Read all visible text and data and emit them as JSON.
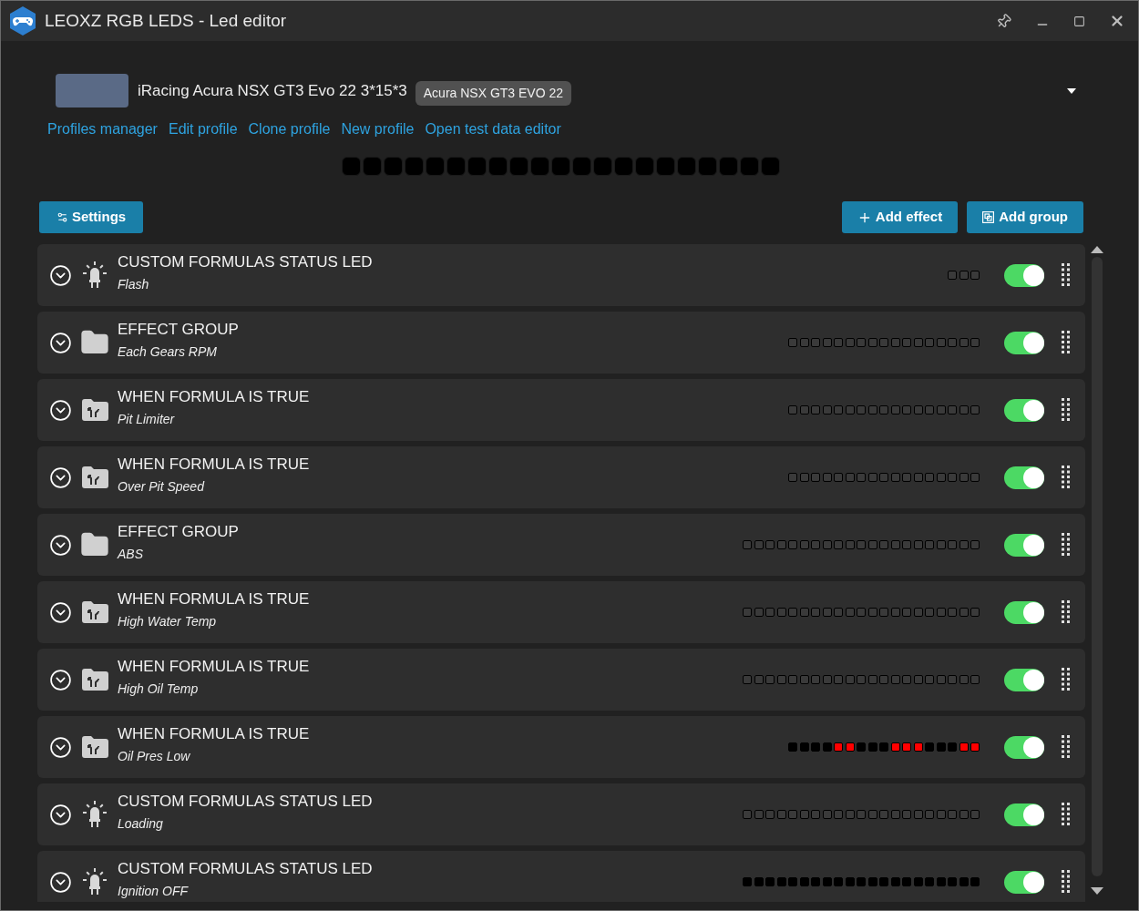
{
  "window": {
    "title": "LEOXZ RGB LEDS - Led editor"
  },
  "profile": {
    "name": "iRacing Acura NSX GT3 Evo 22 3*15*3",
    "badge": "Acura NSX GT3 EVO 22"
  },
  "links": [
    "Profiles manager",
    "Edit profile",
    "Clone profile",
    "New profile",
    "Open test data editor"
  ],
  "preview_leds": [
    {
      "color": "#000000"
    },
    {
      "color": "#000000"
    },
    {
      "color": "#000000"
    },
    {
      "color": "#000000"
    },
    {
      "color": "#000000"
    },
    {
      "color": "#000000"
    },
    {
      "color": "#000000"
    },
    {
      "color": "#000000"
    },
    {
      "color": "#000000"
    },
    {
      "color": "#000000"
    },
    {
      "color": "#000000"
    },
    {
      "color": "#000000"
    },
    {
      "color": "#000000"
    },
    {
      "color": "#000000"
    },
    {
      "color": "#000000"
    },
    {
      "color": "#000000"
    },
    {
      "color": "#000000"
    },
    {
      "color": "#000000"
    },
    {
      "color": "#000000"
    },
    {
      "color": "#000000"
    },
    {
      "color": "#000000"
    }
  ],
  "toolbar": {
    "settings": "Settings",
    "add_effect": "Add effect",
    "add_group": "Add group"
  },
  "effects": [
    {
      "kind": "status_led",
      "title": "CUSTOM FORMULAS STATUS LED",
      "subtitle": "Flash",
      "on": true,
      "leds": [
        {
          "kind": "outline"
        },
        {
          "kind": "outline"
        },
        {
          "kind": "outline"
        }
      ]
    },
    {
      "kind": "group",
      "title": "EFFECT GROUP",
      "subtitle": "Each Gears RPM",
      "on": true,
      "leds": [
        {
          "kind": "outline"
        },
        {
          "kind": "outline"
        },
        {
          "kind": "outline"
        },
        {
          "kind": "outline"
        },
        {
          "kind": "outline"
        },
        {
          "kind": "outline"
        },
        {
          "kind": "outline"
        },
        {
          "kind": "outline"
        },
        {
          "kind": "outline"
        },
        {
          "kind": "outline"
        },
        {
          "kind": "outline"
        },
        {
          "kind": "outline"
        },
        {
          "kind": "outline"
        },
        {
          "kind": "outline"
        },
        {
          "kind": "outline"
        },
        {
          "kind": "outline"
        },
        {
          "kind": "outline"
        }
      ]
    },
    {
      "kind": "formula",
      "title": "WHEN FORMULA IS TRUE",
      "subtitle": "Pit Limiter",
      "on": true,
      "leds": [
        {
          "kind": "outline"
        },
        {
          "kind": "outline"
        },
        {
          "kind": "outline"
        },
        {
          "kind": "outline"
        },
        {
          "kind": "outline"
        },
        {
          "kind": "outline"
        },
        {
          "kind": "outline"
        },
        {
          "kind": "outline"
        },
        {
          "kind": "outline"
        },
        {
          "kind": "outline"
        },
        {
          "kind": "outline"
        },
        {
          "kind": "outline"
        },
        {
          "kind": "outline"
        },
        {
          "kind": "outline"
        },
        {
          "kind": "outline"
        },
        {
          "kind": "outline"
        },
        {
          "kind": "outline"
        }
      ]
    },
    {
      "kind": "formula",
      "title": "WHEN FORMULA IS TRUE",
      "subtitle": "Over Pit Speed",
      "on": true,
      "leds": [
        {
          "kind": "outline"
        },
        {
          "kind": "outline"
        },
        {
          "kind": "outline"
        },
        {
          "kind": "outline"
        },
        {
          "kind": "outline"
        },
        {
          "kind": "outline"
        },
        {
          "kind": "outline"
        },
        {
          "kind": "outline"
        },
        {
          "kind": "outline"
        },
        {
          "kind": "outline"
        },
        {
          "kind": "outline"
        },
        {
          "kind": "outline"
        },
        {
          "kind": "outline"
        },
        {
          "kind": "outline"
        },
        {
          "kind": "outline"
        },
        {
          "kind": "outline"
        },
        {
          "kind": "outline"
        }
      ]
    },
    {
      "kind": "group",
      "title": "EFFECT GROUP",
      "subtitle": "ABS",
      "on": true,
      "leds": [
        {
          "kind": "outline"
        },
        {
          "kind": "outline"
        },
        {
          "kind": "outline"
        },
        {
          "kind": "outline"
        },
        {
          "kind": "outline"
        },
        {
          "kind": "outline"
        },
        {
          "kind": "outline"
        },
        {
          "kind": "outline"
        },
        {
          "kind": "outline"
        },
        {
          "kind": "outline"
        },
        {
          "kind": "outline"
        },
        {
          "kind": "outline"
        },
        {
          "kind": "outline"
        },
        {
          "kind": "outline"
        },
        {
          "kind": "outline"
        },
        {
          "kind": "outline"
        },
        {
          "kind": "outline"
        },
        {
          "kind": "outline"
        },
        {
          "kind": "outline"
        },
        {
          "kind": "outline"
        },
        {
          "kind": "outline"
        }
      ]
    },
    {
      "kind": "formula",
      "title": "WHEN FORMULA IS TRUE",
      "subtitle": "High Water Temp",
      "on": true,
      "leds": [
        {
          "kind": "outline"
        },
        {
          "kind": "outline"
        },
        {
          "kind": "outline"
        },
        {
          "kind": "outline"
        },
        {
          "kind": "outline"
        },
        {
          "kind": "outline"
        },
        {
          "kind": "outline"
        },
        {
          "kind": "outline"
        },
        {
          "kind": "outline"
        },
        {
          "kind": "outline"
        },
        {
          "kind": "outline"
        },
        {
          "kind": "outline"
        },
        {
          "kind": "outline"
        },
        {
          "kind": "outline"
        },
        {
          "kind": "outline"
        },
        {
          "kind": "outline"
        },
        {
          "kind": "outline"
        },
        {
          "kind": "outline"
        },
        {
          "kind": "outline"
        },
        {
          "kind": "outline"
        },
        {
          "kind": "outline"
        }
      ]
    },
    {
      "kind": "formula",
      "title": "WHEN FORMULA IS TRUE",
      "subtitle": "High Oil Temp",
      "on": true,
      "leds": [
        {
          "kind": "outline"
        },
        {
          "kind": "outline"
        },
        {
          "kind": "outline"
        },
        {
          "kind": "outline"
        },
        {
          "kind": "outline"
        },
        {
          "kind": "outline"
        },
        {
          "kind": "outline"
        },
        {
          "kind": "outline"
        },
        {
          "kind": "outline"
        },
        {
          "kind": "outline"
        },
        {
          "kind": "outline"
        },
        {
          "kind": "outline"
        },
        {
          "kind": "outline"
        },
        {
          "kind": "outline"
        },
        {
          "kind": "outline"
        },
        {
          "kind": "outline"
        },
        {
          "kind": "outline"
        },
        {
          "kind": "outline"
        },
        {
          "kind": "outline"
        },
        {
          "kind": "outline"
        },
        {
          "kind": "outline"
        }
      ]
    },
    {
      "kind": "formula",
      "title": "WHEN FORMULA IS TRUE",
      "subtitle": "Oil Pres Low",
      "on": true,
      "leds": [
        {
          "kind": "lit",
          "color": "#000000"
        },
        {
          "kind": "lit",
          "color": "#000000"
        },
        {
          "kind": "lit",
          "color": "#000000"
        },
        {
          "kind": "lit",
          "color": "#000000"
        },
        {
          "kind": "lit",
          "color": "#ff0000"
        },
        {
          "kind": "lit",
          "color": "#ff0000"
        },
        {
          "kind": "lit",
          "color": "#000000"
        },
        {
          "kind": "lit",
          "color": "#000000"
        },
        {
          "kind": "lit",
          "color": "#000000"
        },
        {
          "kind": "lit",
          "color": "#ff0000"
        },
        {
          "kind": "lit",
          "color": "#ff0000"
        },
        {
          "kind": "lit",
          "color": "#ff0000"
        },
        {
          "kind": "lit",
          "color": "#000000"
        },
        {
          "kind": "lit",
          "color": "#000000"
        },
        {
          "kind": "lit",
          "color": "#000000"
        },
        {
          "kind": "lit",
          "color": "#ff0000"
        },
        {
          "kind": "lit",
          "color": "#ff0000"
        }
      ]
    },
    {
      "kind": "status_led",
      "title": "CUSTOM FORMULAS STATUS LED",
      "subtitle": "Loading",
      "on": true,
      "leds": [
        {
          "kind": "outline"
        },
        {
          "kind": "outline"
        },
        {
          "kind": "outline"
        },
        {
          "kind": "outline"
        },
        {
          "kind": "outline"
        },
        {
          "kind": "outline"
        },
        {
          "kind": "outline"
        },
        {
          "kind": "outline"
        },
        {
          "kind": "outline"
        },
        {
          "kind": "outline"
        },
        {
          "kind": "outline"
        },
        {
          "kind": "outline"
        },
        {
          "kind": "outline"
        },
        {
          "kind": "outline"
        },
        {
          "kind": "outline"
        },
        {
          "kind": "outline"
        },
        {
          "kind": "outline"
        },
        {
          "kind": "outline"
        },
        {
          "kind": "outline"
        },
        {
          "kind": "outline"
        },
        {
          "kind": "outline"
        }
      ]
    },
    {
      "kind": "status_led",
      "title": "CUSTOM FORMULAS STATUS LED",
      "subtitle": "Ignition OFF",
      "on": true,
      "leds": [
        {
          "kind": "lit",
          "color": "#000000"
        },
        {
          "kind": "lit",
          "color": "#000000"
        },
        {
          "kind": "lit",
          "color": "#000000"
        },
        {
          "kind": "lit",
          "color": "#000000"
        },
        {
          "kind": "lit",
          "color": "#000000"
        },
        {
          "kind": "lit",
          "color": "#000000"
        },
        {
          "kind": "lit",
          "color": "#000000"
        },
        {
          "kind": "lit",
          "color": "#000000"
        },
        {
          "kind": "lit",
          "color": "#000000"
        },
        {
          "kind": "lit",
          "color": "#000000"
        },
        {
          "kind": "lit",
          "color": "#000000"
        },
        {
          "kind": "lit",
          "color": "#000000"
        },
        {
          "kind": "lit",
          "color": "#000000"
        },
        {
          "kind": "lit",
          "color": "#000000"
        },
        {
          "kind": "lit",
          "color": "#000000"
        },
        {
          "kind": "lit",
          "color": "#000000"
        },
        {
          "kind": "lit",
          "color": "#000000"
        },
        {
          "kind": "lit",
          "color": "#000000"
        },
        {
          "kind": "lit",
          "color": "#000000"
        },
        {
          "kind": "lit",
          "color": "#000000"
        },
        {
          "kind": "lit",
          "color": "#000000"
        }
      ]
    }
  ]
}
